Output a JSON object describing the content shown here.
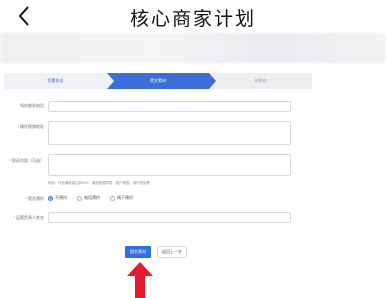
{
  "header": {
    "title": "核心商家计划"
  },
  "steps": [
    {
      "label": "签署协议",
      "state": "done"
    },
    {
      "label": "提交素材",
      "state": "active"
    },
    {
      "label": "待审核",
      "state": "todo"
    }
  ],
  "form": {
    "field1": {
      "label": "所在联系电话",
      "required": false,
      "value": ""
    },
    "field2": {
      "label": "操作视频地址",
      "required": true,
      "value": ""
    },
    "field3": {
      "label": "投诉内容（可选）",
      "required": true,
      "value": "",
      "hint": "例如：作品播放量达到XXX，播放数据异常，账户原因，请尽快处理"
    },
    "field4": {
      "label": "是否预约",
      "required": true,
      "options": [
        "不预约",
        "电话预约",
        "线下预约"
      ],
      "selected_index": 0
    },
    "field5": {
      "label": "运营负责人姓名",
      "required": true,
      "value": ""
    }
  },
  "buttons": {
    "submit": "提交素材",
    "back": "返回上一步"
  },
  "colors": {
    "primary": "#2f6fe0",
    "annotation_arrow": "#e8192c"
  }
}
